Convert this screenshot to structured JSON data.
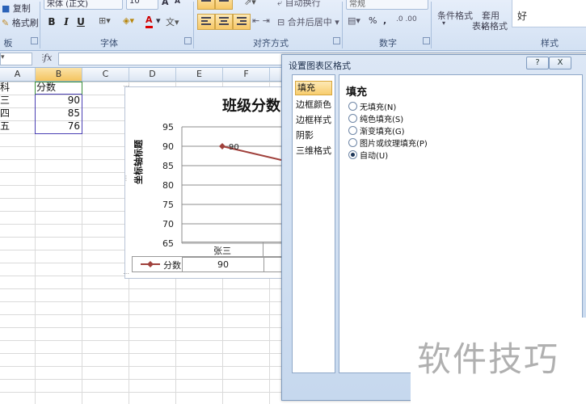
{
  "ribbon": {
    "clipboard": {
      "copy": "复制",
      "format_painter": "格式刷",
      "group_label": "板"
    },
    "font": {
      "font_name": "宋体 (正文)",
      "font_size": "10",
      "grow": "A",
      "shrink": "A",
      "bold": "B",
      "italic": "I",
      "underline": "U",
      "font_color_glyph": "A",
      "group_label": "字体"
    },
    "alignment": {
      "wrap": "自动换行",
      "merge": "合并后居中",
      "group_label": "对齐方式"
    },
    "number": {
      "format": "常规",
      "percent": "%",
      "comma": ",",
      "group_label": "数字"
    },
    "styles": {
      "conditional": "条件格式",
      "table_line1": "套用",
      "table_line2": "表格格式",
      "good": "好",
      "group_label": "样式"
    }
  },
  "formula_bar": {
    "fx": "fx",
    "value": ""
  },
  "sheet": {
    "columns": [
      "A",
      "B",
      "C",
      "D",
      "E",
      "F"
    ],
    "rows": [
      {
        "a": "科",
        "b": "分数"
      },
      {
        "a": "三",
        "b": "90"
      },
      {
        "a": "四",
        "b": "85"
      },
      {
        "a": "五",
        "b": "76"
      }
    ]
  },
  "chart": {
    "title": "班级分数",
    "ylabel": "坐标轴标题",
    "legend_series": "分数",
    "table_header": "张三",
    "table_value": "90"
  },
  "chart_data": {
    "type": "line",
    "title": "班级分数",
    "ylabel": "坐标轴标题",
    "categories": [
      "张三"
    ],
    "series": [
      {
        "name": "分数",
        "values": [
          90
        ]
      }
    ],
    "ylim": [
      65,
      95
    ],
    "yticks": [
      95,
      90,
      85,
      80,
      75,
      70,
      65
    ],
    "data_labels": [
      "90"
    ],
    "color": "#a0413c"
  },
  "dialog": {
    "title": "设置图表区格式",
    "help": "?",
    "close": "X",
    "nav": [
      "填充",
      "边框颜色",
      "边框样式",
      "阴影",
      "三维格式"
    ],
    "section_title": "填充",
    "options": [
      {
        "label": "无填充(N)",
        "selected": false
      },
      {
        "label": "纯色填充(S)",
        "selected": false
      },
      {
        "label": "渐变填充(G)",
        "selected": false
      },
      {
        "label": "图片或纹理填充(P)",
        "selected": false
      },
      {
        "label": "自动(U)",
        "selected": true
      }
    ]
  },
  "watermark": {
    "text": "软件技巧"
  }
}
